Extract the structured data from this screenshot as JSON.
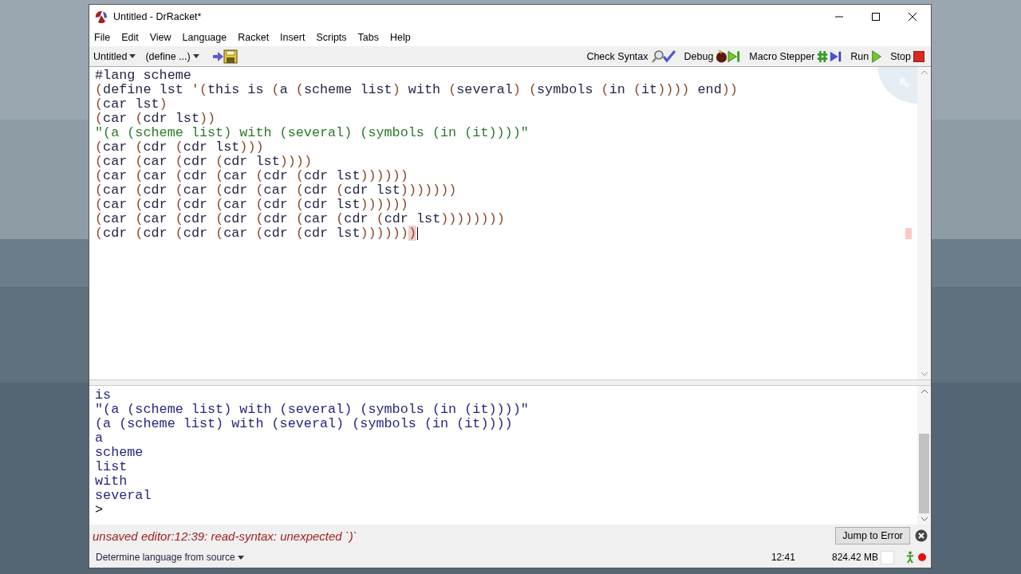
{
  "window": {
    "title": "Untitled - DrRacket*"
  },
  "menu": [
    "File",
    "Edit",
    "View",
    "Language",
    "Racket",
    "Insert",
    "Scripts",
    "Tabs",
    "Help"
  ],
  "toolbar": {
    "file_menu": "Untitled",
    "define_menu": "(define ...)",
    "buttons": [
      {
        "label": "Check Syntax",
        "kind": "check"
      },
      {
        "label": "Debug",
        "kind": "debug"
      },
      {
        "label": "Macro Stepper",
        "kind": "macro"
      },
      {
        "label": "Run",
        "kind": "run"
      },
      {
        "label": "Stop",
        "kind": "stop"
      }
    ]
  },
  "editor": {
    "lines": [
      {
        "text": "#lang scheme",
        "kind": "lang",
        "error_mark": false,
        "caret": false
      },
      {
        "text": "(define lst '(this is (a (scheme list) with (several) (symbols (in (it)))) end))",
        "kind": "code",
        "error_mark": false,
        "caret": false
      },
      {
        "text": "(car lst)",
        "kind": "code",
        "error_mark": false,
        "caret": false
      },
      {
        "text": "(car (cdr lst))",
        "kind": "code",
        "error_mark": false,
        "caret": false
      },
      {
        "text": "\"(a (scheme list) with (several) (symbols (in (it))))\"",
        "kind": "string",
        "error_mark": false,
        "caret": false
      },
      {
        "text": "(car (cdr (cdr lst)))",
        "kind": "code",
        "error_mark": false,
        "caret": false
      },
      {
        "text": "(car (car (cdr (cdr lst))))",
        "kind": "code",
        "error_mark": false,
        "caret": false
      },
      {
        "text": "(car (car (cdr (car (cdr (cdr lst))))))",
        "kind": "code",
        "error_mark": false,
        "caret": false
      },
      {
        "text": "(car (cdr (car (cdr (car (cdr (cdr lst)))))))",
        "kind": "code",
        "error_mark": false,
        "caret": false
      },
      {
        "text": "(car (cdr (cdr (car (cdr (cdr lst))))))",
        "kind": "code",
        "error_mark": false,
        "caret": false
      },
      {
        "text": "(car (car (cdr (cdr (cdr (car (cdr (cdr lst))))))))",
        "kind": "code",
        "error_mark": false,
        "caret": false
      },
      {
        "text": "(cdr (cdr (cdr (car (cdr (cdr lst)))))))",
        "kind": "code",
        "error_mark": true,
        "caret": true
      }
    ]
  },
  "repl": {
    "lines": [
      "is",
      "\"(a (scheme list) with (several) (symbols (in (it))))\"",
      "(a (scheme list) with (several) (symbols (in (it))))",
      "a",
      "scheme",
      "list",
      "with",
      "several"
    ],
    "prompt": ">"
  },
  "error": {
    "message": "unsaved editor:12:39: read-syntax: unexpected `)`",
    "button": "Jump to Error"
  },
  "status_bar": {
    "language": "Determine language from source",
    "position": "12:41",
    "memory": "824.42 MB"
  }
}
